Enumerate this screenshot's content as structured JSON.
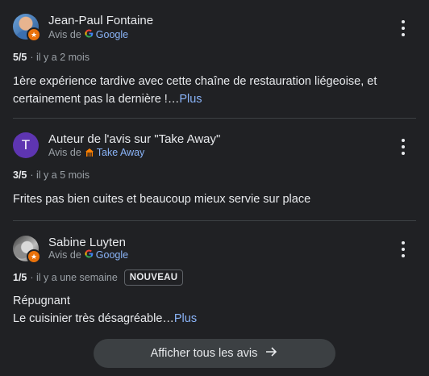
{
  "reviews": [
    {
      "author": "Jean-Paul Fontaine",
      "source_prefix": "Avis de",
      "source_name": "Google",
      "rating": "5/5",
      "time": "· il y a 2 mois",
      "text": "1ère expérience tardive avec cette chaîne de restauration liégeoise, et certainement pas la dernière !…",
      "more_label": "Plus"
    },
    {
      "author": "Auteur de l'avis sur \"Take Away\"",
      "avatar_letter": "T",
      "source_prefix": "Avis de",
      "source_name": "Take Away",
      "rating": "3/5",
      "time": "· il y a 5 mois",
      "text": "Frites pas bien cuites et beaucoup mieux servie sur place"
    },
    {
      "author": "Sabine Luyten",
      "source_prefix": "Avis de",
      "source_name": "Google",
      "rating": "1/5",
      "time": "· il y a une semaine",
      "badge": "NOUVEAU",
      "text_line1": "Répugnant",
      "text_line2": "Le cuisinier très désagréable…",
      "more_label": "Plus"
    }
  ],
  "show_all_label": "Afficher tous les avis",
  "colors": {
    "background": "#202124",
    "link": "#8ab4f8",
    "badge_orange": "#e8710a",
    "avatar_purple": "#5e35b1"
  }
}
